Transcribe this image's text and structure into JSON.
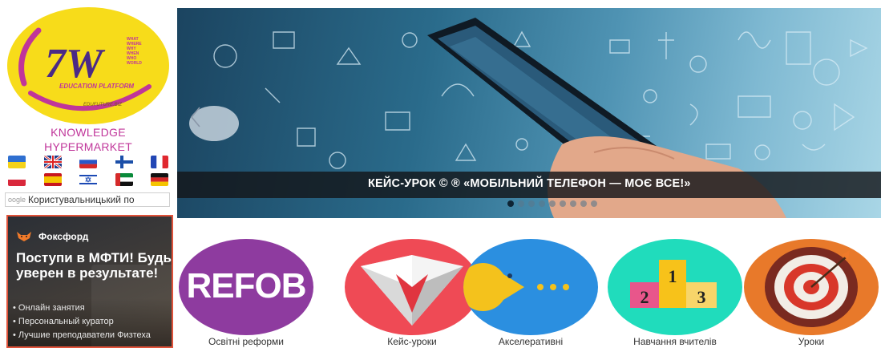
{
  "logo": {
    "mark": "7W",
    "tagline": "WHAT WHERE WHY WHEN WHO WORLD",
    "platform": "EDUCATION PLATFORM",
    "site": "EDUFUTURE.BIZ"
  },
  "site_title": [
    "KNOWLEDGE",
    "HYPERMARKET"
  ],
  "languages": [
    [
      "ukraine-flag",
      "uk-flag",
      "russia-flag",
      "finland-flag",
      "france-flag"
    ],
    [
      "poland-flag",
      "spain-flag",
      "israel-flag",
      "uae-flag",
      "germany-flag"
    ]
  ],
  "search": {
    "google_label": "oogle",
    "placeholder": "Користувальницький по"
  },
  "ad": {
    "brand": "Фоксфорд",
    "headline": "Поступи в МФТИ! Будь уверен в результате!",
    "bullets": [
      "Онлайн занятия",
      "Персональный куратор",
      "Лучшие преподаватели Физтеха"
    ]
  },
  "slider": {
    "caption": "КЕЙС-УРОК © ® «МОБІЛЬНИЙ ТЕЛЕФОН — МОЄ ВСЕ!»",
    "dot_count": 9,
    "active_index": 0,
    "prev_icon": "chevron-left-icon"
  },
  "tiles": [
    {
      "label": "Освітні реформи",
      "text": "REFOB",
      "color": "#8e3b9f"
    },
    {
      "label": "Кейс-уроки",
      "color": "#ef4a55"
    },
    {
      "label": "Акселеративні",
      "color": "#2b8fe0"
    },
    {
      "label": "Навчання вчителів",
      "color": "#20dcbc",
      "podium": [
        "1",
        "2",
        "3"
      ]
    },
    {
      "label": "Уроки",
      "color": "#e8792a"
    }
  ]
}
